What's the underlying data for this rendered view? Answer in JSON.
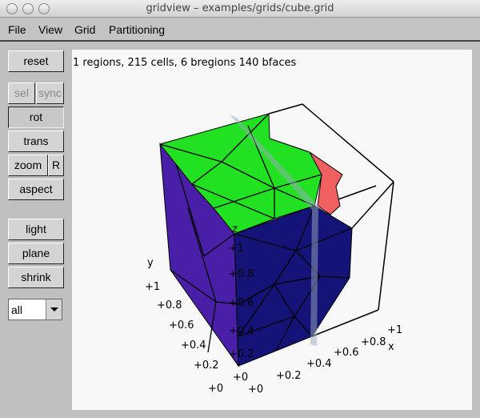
{
  "window": {
    "title": "gridview – examples/grids/cube.grid"
  },
  "menu": [
    "File",
    "View",
    "Grid",
    "Partitioning"
  ],
  "sidebar": {
    "reset": "reset",
    "sel": "sel",
    "sync": "sync",
    "rot": "rot",
    "trans": "trans",
    "zoom": "zoom",
    "r": "R",
    "aspect": "aspect",
    "light": "light",
    "plane": "plane",
    "shrink": "shrink",
    "select_value": "all"
  },
  "status": "1 regions, 215 cells, 6 bregions 140 bfaces",
  "axes": {
    "x": {
      "label": "x",
      "ticks": [
        "+0",
        "+0.2",
        "+0.4",
        "+0.6",
        "+0.8",
        "+1"
      ]
    },
    "y": {
      "label": "y",
      "ticks": [
        "+0",
        "+0.2",
        "+0.4",
        "+0.6",
        "+0.8",
        "+1"
      ]
    },
    "z": {
      "label": "z",
      "ticks": [
        "+0",
        "+0.2",
        "+0.4",
        "+0.6",
        "+0.8",
        "+1"
      ]
    }
  },
  "colors": {
    "top_face": "#22e022",
    "side_face": "#4a1fa8",
    "front_face": "#141478",
    "cut_face": "#f06060",
    "plane": "#9ab"
  }
}
